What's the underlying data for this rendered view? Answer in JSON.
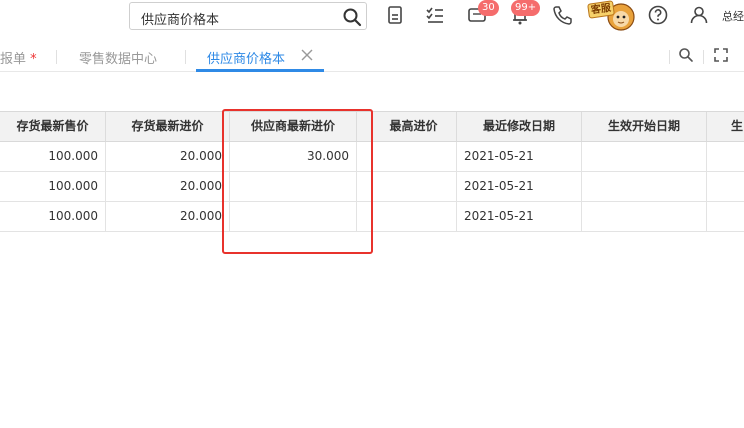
{
  "header": {
    "search_value": "供应商价格本",
    "messages_badge": "30",
    "notifications_badge": "99+",
    "service_label": "客服",
    "user_label": "总经"
  },
  "tabs": [
    {
      "label": "报单",
      "required_mark": "*"
    },
    {
      "label": "零售数据中心"
    },
    {
      "label": "供应商价格本",
      "active": true
    }
  ],
  "table": {
    "columns": [
      "存货最新售价",
      "存货最新进价",
      "供应商最新进价",
      "",
      "最高进价",
      "最近修改日期",
      "生效开始日期",
      "生"
    ],
    "rows": [
      [
        "100.000",
        "20.000",
        "30.000",
        "",
        "",
        "2021-05-21",
        "",
        ""
      ],
      [
        "100.000",
        "20.000",
        "",
        "",
        "",
        "2021-05-21",
        "",
        ""
      ],
      [
        "100.000",
        "20.000",
        "",
        "",
        "",
        "2021-05-21",
        "",
        ""
      ]
    ]
  },
  "colors": {
    "accent": "#2f8ae6",
    "highlight": "#e8322c",
    "badge": "#f56c6c"
  }
}
